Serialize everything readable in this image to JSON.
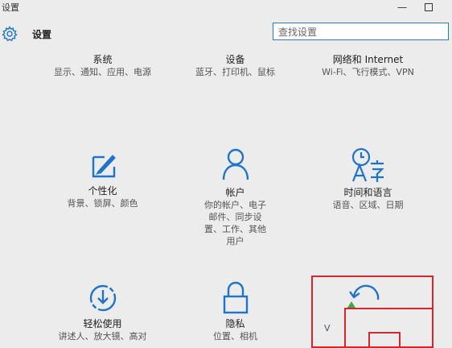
{
  "window": {
    "title": "设置",
    "minimize": "—"
  },
  "header": {
    "title": "设置",
    "search_placeholder": "查找设置"
  },
  "tiles": [
    {
      "name": "系统",
      "desc": "显示、通知、应用、电源"
    },
    {
      "name": "设备",
      "desc": "蓝牙、打印机、鼠标"
    },
    {
      "name": "网络和 Internet",
      "desc": "Wi-Fi、飞行模式、VPN"
    },
    {
      "name": "个性化",
      "desc": "背景、锁屏、颜色",
      "icon": "personalization-icon"
    },
    {
      "name": "帐户",
      "desc": "你的帐户、电子邮件、同步设置、工作、其他用户",
      "icon": "account-icon"
    },
    {
      "name": "时间和语言",
      "desc": "语音、区域、日期",
      "icon": "time-language-icon"
    },
    {
      "name": "轻松使用",
      "desc": "讲述人、放大镜、高对",
      "icon": "ease-of-access-icon"
    },
    {
      "name": "隐私",
      "desc": "位置、相机",
      "icon": "lock-icon"
    },
    {
      "name": "",
      "desc": "V",
      "icon": "update-icon"
    }
  ],
  "colors": {
    "accent": "#1f74c9",
    "highlight": "#d9262b"
  }
}
